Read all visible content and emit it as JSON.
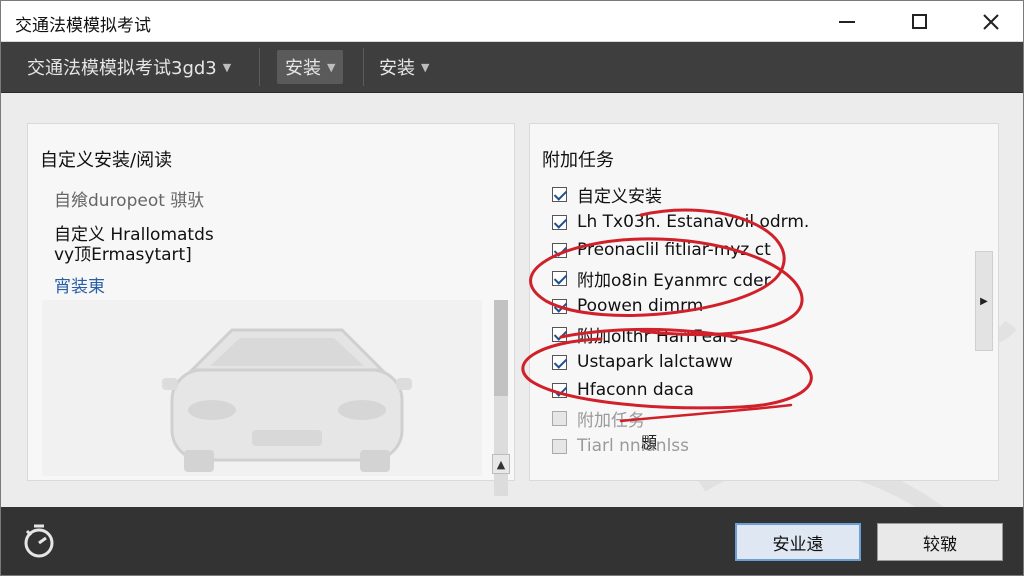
{
  "window": {
    "title": "交通法模模拟考试",
    "controls": {
      "minimize": "minimize",
      "maximize": "maximize",
      "close": "close"
    }
  },
  "toolbar": {
    "app_menu": "交通法模模拟考试3gd3",
    "install_active": "安装",
    "install_plain": "安装"
  },
  "left_panel": {
    "heading": "自定义安装/阅读",
    "line1": "自飨duropeot 骐驮",
    "line2": "自定义 Hrallomatds",
    "line3": "vy顶Ermasytart]",
    "link": "宵装東",
    "scroll_up": "▲"
  },
  "right_panel": {
    "heading": "附加任务",
    "tasks": [
      {
        "label": "自定义安装",
        "checked": true
      },
      {
        "label": "Lh Tx03h. Estanavoil odrm.",
        "checked": true
      },
      {
        "label": "Preonaclil fitliar-myz ct",
        "checked": true
      },
      {
        "label": "附加o8in Eyanmrc cder",
        "checked": true
      },
      {
        "label": "Poowen dimrm",
        "checked": true
      },
      {
        "label": "附加olthr HarrFears",
        "checked": true
      },
      {
        "label": "Ustapark lalctaww",
        "checked": true
      },
      {
        "label": "Hfaconn daca",
        "checked": true
      },
      {
        "label": "附加任务",
        "checked": false
      },
      {
        "label": "Tiarl nnlanlss",
        "checked": false
      }
    ],
    "stray": "顋",
    "side_arrow": "▶"
  },
  "footer": {
    "primary_button": "安业遠",
    "secondary_button": "较皲"
  },
  "colors": {
    "toolbar_bg": "#3e3e3e",
    "footer_bg": "#333333",
    "annotation_red": "#d0202a",
    "link_blue": "#2a5fa8",
    "primary_button_border": "#6aa0d6"
  }
}
